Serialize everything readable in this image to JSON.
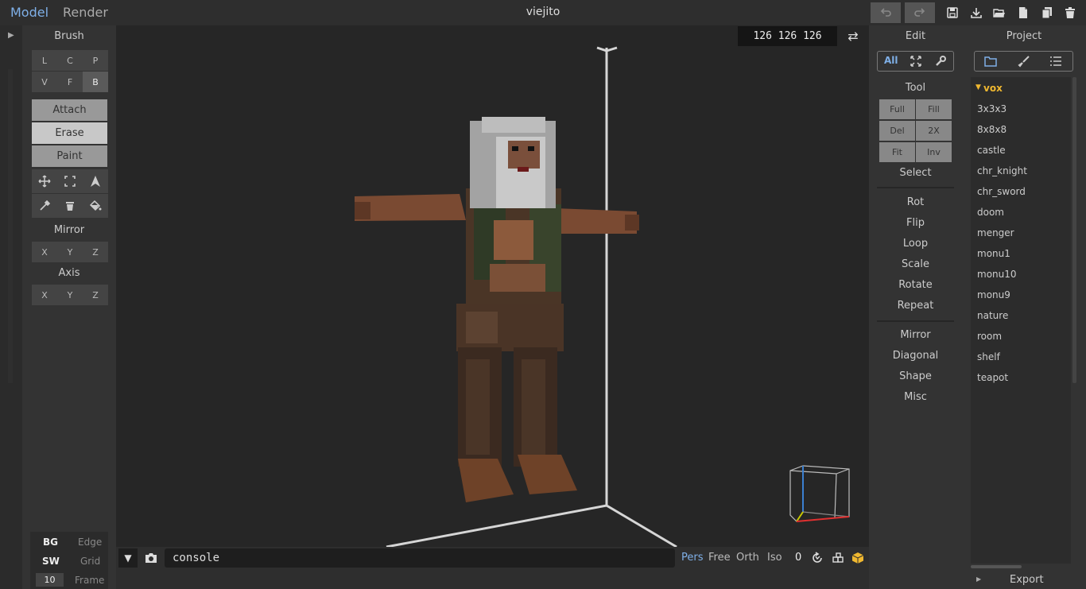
{
  "app": {
    "tabs": {
      "model": "Model",
      "render": "Render"
    },
    "title": "viejito",
    "accent": "#7fb0e8"
  },
  "toolbar": {
    "icons": [
      "undo-icon",
      "redo-icon",
      "save-icon",
      "download-icon",
      "open-folder-icon",
      "new-file-icon",
      "copy-icon",
      "trash-icon"
    ]
  },
  "brush": {
    "header": "Brush",
    "modes": [
      "L",
      "C",
      "P",
      "V",
      "F",
      "B"
    ],
    "selected_mode": "B",
    "actions": [
      "Attach",
      "Erase",
      "Paint"
    ],
    "selected_action": "Erase",
    "icons": [
      "move-icon",
      "select-region-icon",
      "cursor-icon",
      "eyedropper-icon",
      "trash-icon",
      "fill-bucket-icon"
    ]
  },
  "mirror": {
    "header": "Mirror",
    "axes": [
      "X",
      "Y",
      "Z"
    ]
  },
  "axis": {
    "header": "Axis",
    "axes": [
      "X",
      "Y",
      "Z"
    ]
  },
  "display": {
    "bg_label": "BG",
    "edge_label": "Edge",
    "sw_label": "SW",
    "grid_label": "Grid",
    "frame_value": "10",
    "frame_label": "Frame"
  },
  "viewport": {
    "dimensions": "126 126 126",
    "swap_icon": "swap-icon"
  },
  "bottom": {
    "console_text": "console",
    "view_modes": [
      "Pers",
      "Free",
      "Orth",
      "Iso"
    ],
    "active_view": "Pers",
    "zero_value": "0"
  },
  "edit": {
    "header": "Edit",
    "tabs": [
      "All"
    ],
    "tool_header": "Tool",
    "tool_buttons": [
      "Full",
      "Fill",
      "Del",
      "2X",
      "Fit",
      "Inv"
    ],
    "select_label": "Select",
    "group1": [
      "Rot",
      "Flip",
      "Loop",
      "Scale",
      "Rotate",
      "Repeat"
    ],
    "group2": [
      "Mirror",
      "Diagonal",
      "Shape",
      "Misc"
    ]
  },
  "project": {
    "header": "Project",
    "folder": "vox",
    "folder_color": "#f0b830",
    "files": [
      "3x3x3",
      "8x8x8",
      "castle",
      "chr_knight",
      "chr_sword",
      "doom",
      "menger",
      "monu1",
      "monu10",
      "monu9",
      "nature",
      "room",
      "shelf",
      "teapot"
    ],
    "export_label": "Export"
  }
}
